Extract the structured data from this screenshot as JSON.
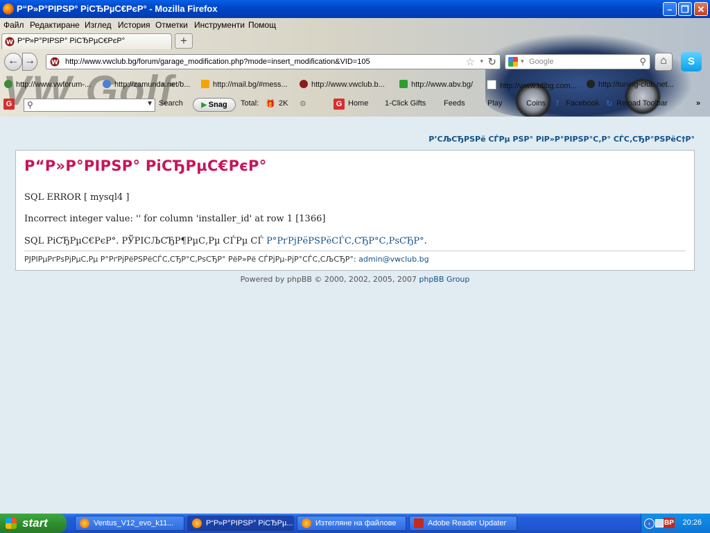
{
  "window": {
    "title": "Р“Р»Р°РІРЅР° РіСЂРµС€РєР° - Mozilla Firefox"
  },
  "menu": [
    "Файл",
    "Редактиране",
    "Изглед",
    "История",
    "Отметки",
    "Инструменти",
    "Помощ"
  ],
  "tab": {
    "title": "Р“Р»Р°РІРЅР° РіСЂРµС€РєР°",
    "new_tab": "+"
  },
  "nav": {
    "url": "http://www.vwclub.bg/forum/garage_modification.php?mode=insert_modification&VID=105",
    "search_placeholder": "Google"
  },
  "background_text": "VW Golf",
  "bookmarks": [
    "http://www.vwforum-...",
    "http://zamunda.net/b...",
    "http://mail.bg/#mess...",
    "http://www.vwclub.b...",
    "http://www.abv.bg/",
    "http://www.tdibg.com...",
    "http://tuning-club.net..."
  ],
  "toolbar2": {
    "search_label": "Search",
    "snag_label": "Snag",
    "total_label": "Total:",
    "total_value": "2K",
    "home": "Home",
    "gifts": "1-Click Gifts",
    "feeds": "Feeds",
    "play": "Play",
    "coins": "Coins",
    "facebook": "Facebook",
    "reload": "Reload Toolbar"
  },
  "content": {
    "faq_link": "Р’СЉСЂРЅРё СЃРµ РЅР° РіР»Р°РІРЅР°С‚Р° СЃС‚СЂР°РЅРёС†Р°",
    "heading": "Р“Р»Р°РІРЅР° РіСЂРµС€РєР°",
    "sql_error": "SQL ERROR [ mysql4 ]",
    "error_message": "Incorrect integer value: '' for column 'installer_id' at row 1 [1366]",
    "sql_notice": "SQL РіСЂРµС€РєР°. РЎРІСЉСЂР¶РµС‚Рµ СЃРµ СЃ",
    "sql_notice_link": "Р°РґРјРёРЅРёСЃС‚СЂР°С‚РѕСЂР°",
    "sql_notice_end": ".",
    "footer_text": "РЈРІРµРґРѕРјРµС‚Рµ Р°РґРјРёРЅРёСЃС‚СЂР°С‚РѕСЂР° РёР»Рё СЃРјРµ-РјР°СЃС‚СЉСЂР°:",
    "footer_email": "admin@vwclub.bg",
    "powered_prefix": "Powered by phpBB © 2000, 2002, 2005, 2007",
    "powered_link": "phpBB Group"
  },
  "taskbar": {
    "start": "start",
    "tasks": [
      "Ventus_V12_evo_k11...",
      "Р“Р»Р°РІРЅР° РіСЂРµ...",
      "Изтегляне на файлове",
      "Adobe Reader Updater"
    ],
    "lang": "BP",
    "clock": "20:26"
  }
}
